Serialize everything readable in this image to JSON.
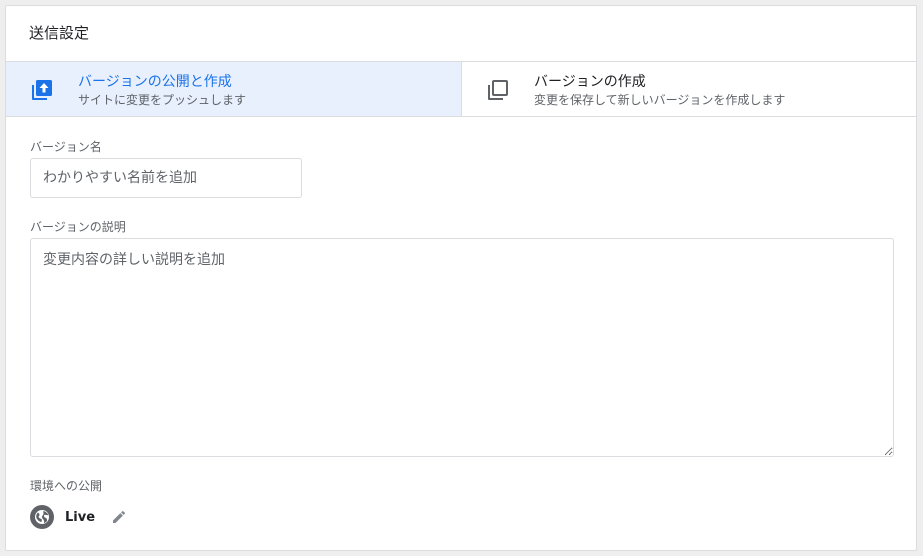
{
  "dialog": {
    "title": "送信設定"
  },
  "options": [
    {
      "title": "バージョンの公開と作成",
      "subtitle": "サイトに変更をプッシュします",
      "icon": "publish-upload-icon",
      "selected": true
    },
    {
      "title": "バージョンの作成",
      "subtitle": "変更を保存して新しいバージョンを作成します",
      "icon": "copy-version-icon",
      "selected": false
    }
  ],
  "version_name": {
    "label": "バージョン名",
    "placeholder": "わかりやすい名前を追加",
    "value": ""
  },
  "version_description": {
    "label": "バージョンの説明",
    "placeholder": "変更内容の詳しい説明を追加",
    "value": ""
  },
  "environment": {
    "label": "環境への公開",
    "name": "Live",
    "icon": "globe-icon",
    "edit_icon": "pencil-icon"
  },
  "colors": {
    "accent": "#1a73e8",
    "selected_bg": "#e8f0fe",
    "border": "#dadce0",
    "muted": "#5f6368"
  }
}
